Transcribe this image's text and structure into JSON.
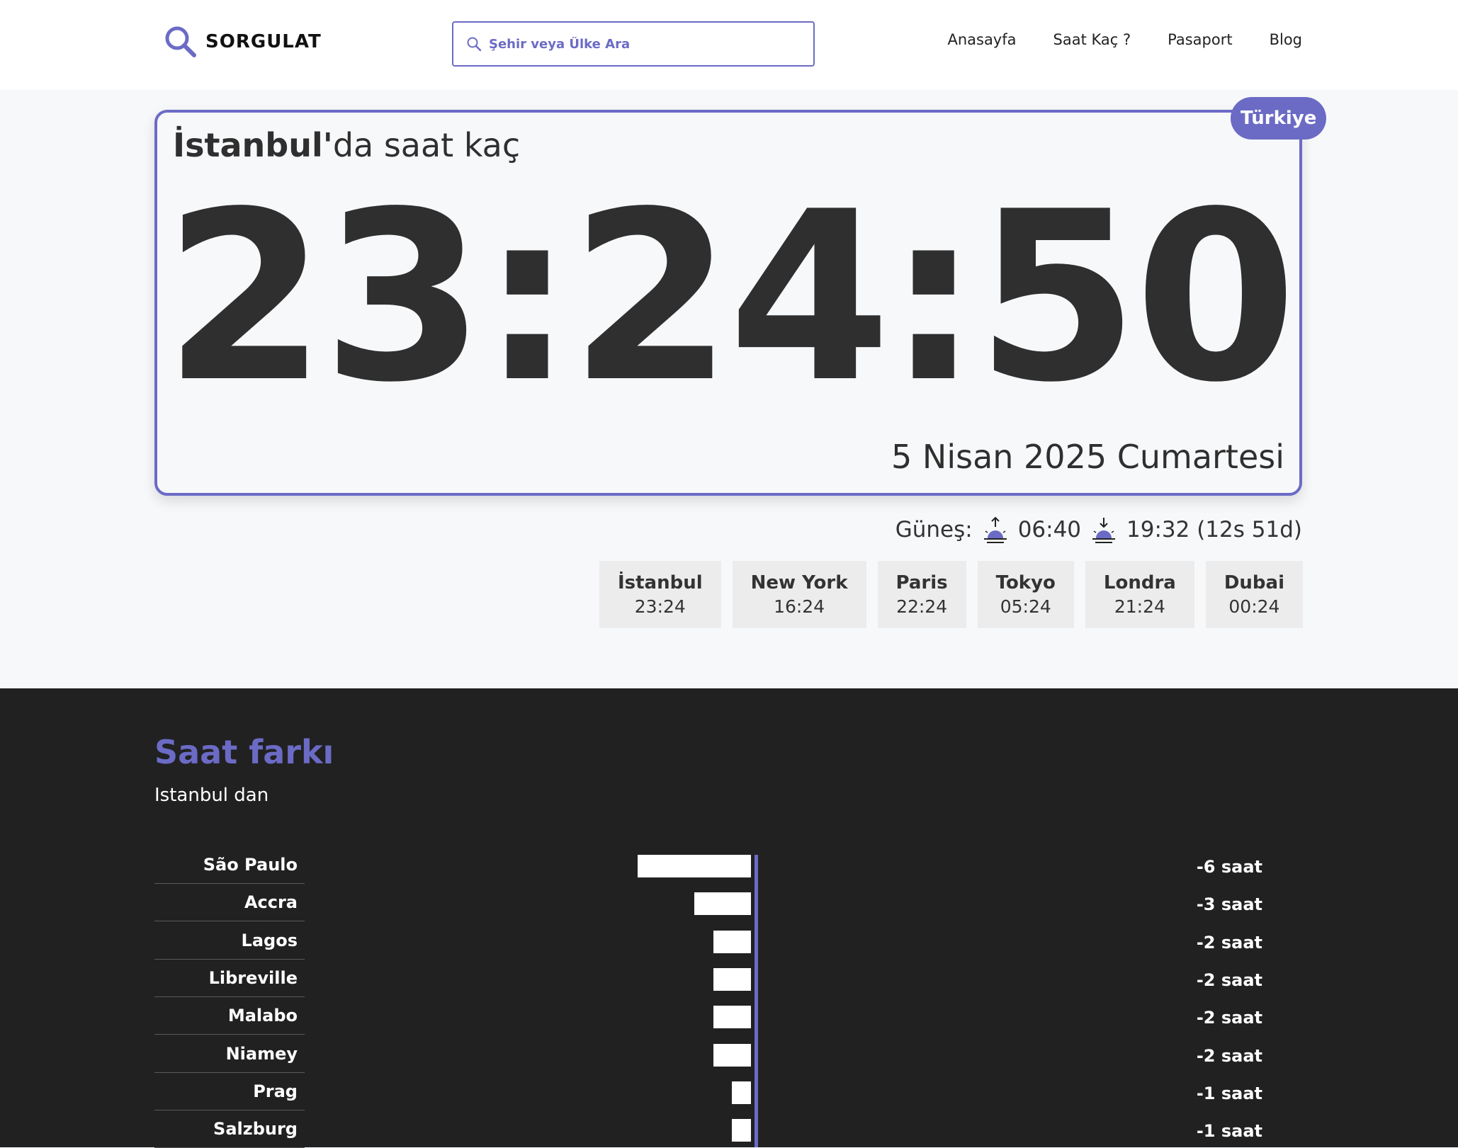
{
  "header": {
    "logo_text": "SORGULAT",
    "search_placeholder": "Şehir veya Ülke Ara",
    "nav": [
      "Anasayfa",
      "Saat Kaç ?",
      "Pasaport",
      "Blog"
    ]
  },
  "clock": {
    "city": "İstanbul'",
    "heading_suffix": "da saat kaç",
    "country": "Türkiye",
    "time": "23:24:50",
    "date": "5 Nisan 2025 Cumartesi"
  },
  "sun": {
    "label": "Güneş:",
    "sunrise": "06:40",
    "sunset": "19:32 (12s 51d)"
  },
  "world_clocks": [
    {
      "city": "İstanbul",
      "time": "23:24"
    },
    {
      "city": "New York",
      "time": "16:24"
    },
    {
      "city": "Paris",
      "time": "22:24"
    },
    {
      "city": "Tokyo",
      "time": "05:24"
    },
    {
      "city": "Londra",
      "time": "21:24"
    },
    {
      "city": "Dubai",
      "time": "00:24"
    }
  ],
  "time_diff": {
    "title": "Saat farkı",
    "subtitle": "Istanbul dan"
  },
  "chart_data": {
    "type": "bar",
    "categories": [
      "São Paulo",
      "Accra",
      "Lagos",
      "Libreville",
      "Malabo",
      "Niamey",
      "Prag",
      "Salzburg"
    ],
    "values": [
      -6,
      -3,
      -2,
      -2,
      -2,
      -2,
      -1,
      -1
    ],
    "value_labels": [
      "-6 saat",
      "-3 saat",
      "-2 saat",
      "-2 saat",
      "-2 saat",
      "-2 saat",
      "-1 saat",
      "-1 saat"
    ]
  },
  "colors": {
    "accent": "#6b6bc6",
    "dark_bg": "#212121",
    "card_bg": "#f7f8fa",
    "text": "#2f2f2f"
  }
}
